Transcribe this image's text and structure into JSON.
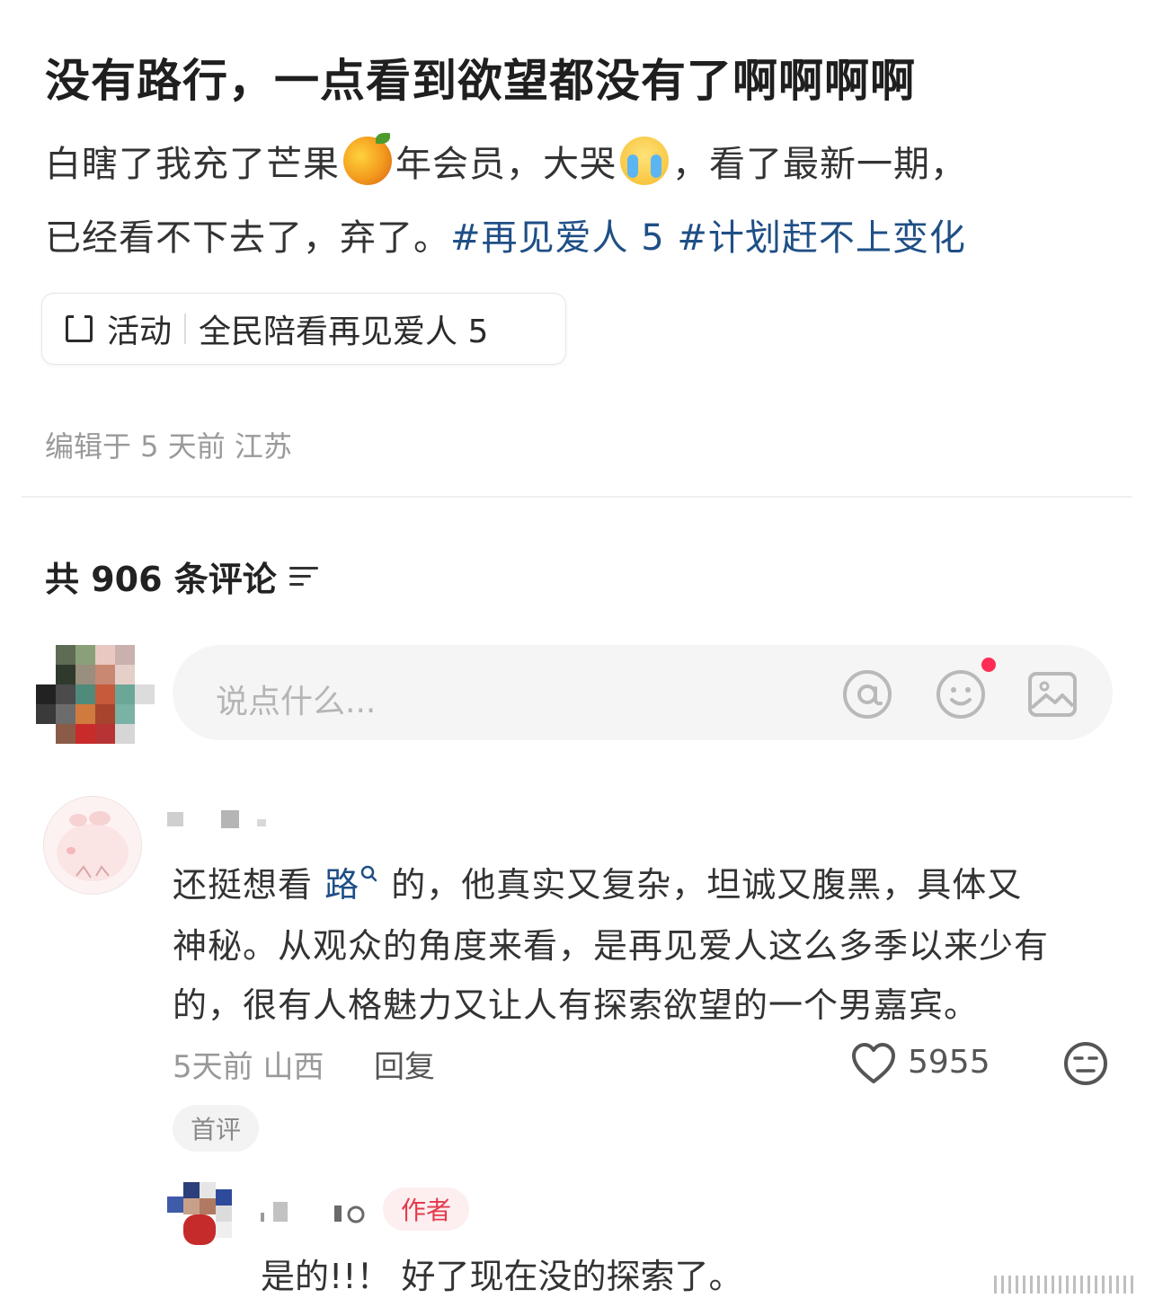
{
  "post": {
    "title": "没有路行，一点看到欲望都没有了啊啊啊啊",
    "body_line1_a": "白瞎了我充了芒果",
    "body_line1_b": "年会员，大哭",
    "body_line1_c": "，看了最新一期，",
    "body_line2_a": "已经看不下去了，弃了。",
    "hashtag1": "#再见爱人 5",
    "hashtag2": "#计划赶不上变化",
    "emoji1": "mango-emoji",
    "emoji2": "crying-face-emoji"
  },
  "activity": {
    "icon": "activity-icon",
    "label": "活动",
    "name": "全民陪看再见爱人 5"
  },
  "meta": {
    "edited": "编辑于 5 天前 江苏"
  },
  "comments_header": {
    "count_label": "共 906 条评论",
    "sort_icon": "sort-icon"
  },
  "composer": {
    "placeholder": "说点什么...",
    "mention_icon": "at-icon",
    "emoji_icon": "smile-icon",
    "image_icon": "image-icon"
  },
  "comment": {
    "line1_a": "还挺想看 ",
    "line1_link": "路",
    "line1_b": " 的，他真实又复杂，坦诚又腹黑，具体又",
    "line2": "神秘。从观众的角度来看，是再见爱人这么多季以来少有",
    "line3": "的，很有人格魅力又让人有探索欲望的一个男嘉宾。",
    "time_location": "5天前 山西",
    "reply_label": "回复",
    "likes": "5955",
    "badge": "首评"
  },
  "reply": {
    "badge": "作者",
    "text": "是的!!！ 好了现在没的探索了。"
  },
  "colors": {
    "hashtag": "#1f4f86",
    "author_badge": "#e33a4b",
    "notification_dot": "#ff2d55"
  }
}
